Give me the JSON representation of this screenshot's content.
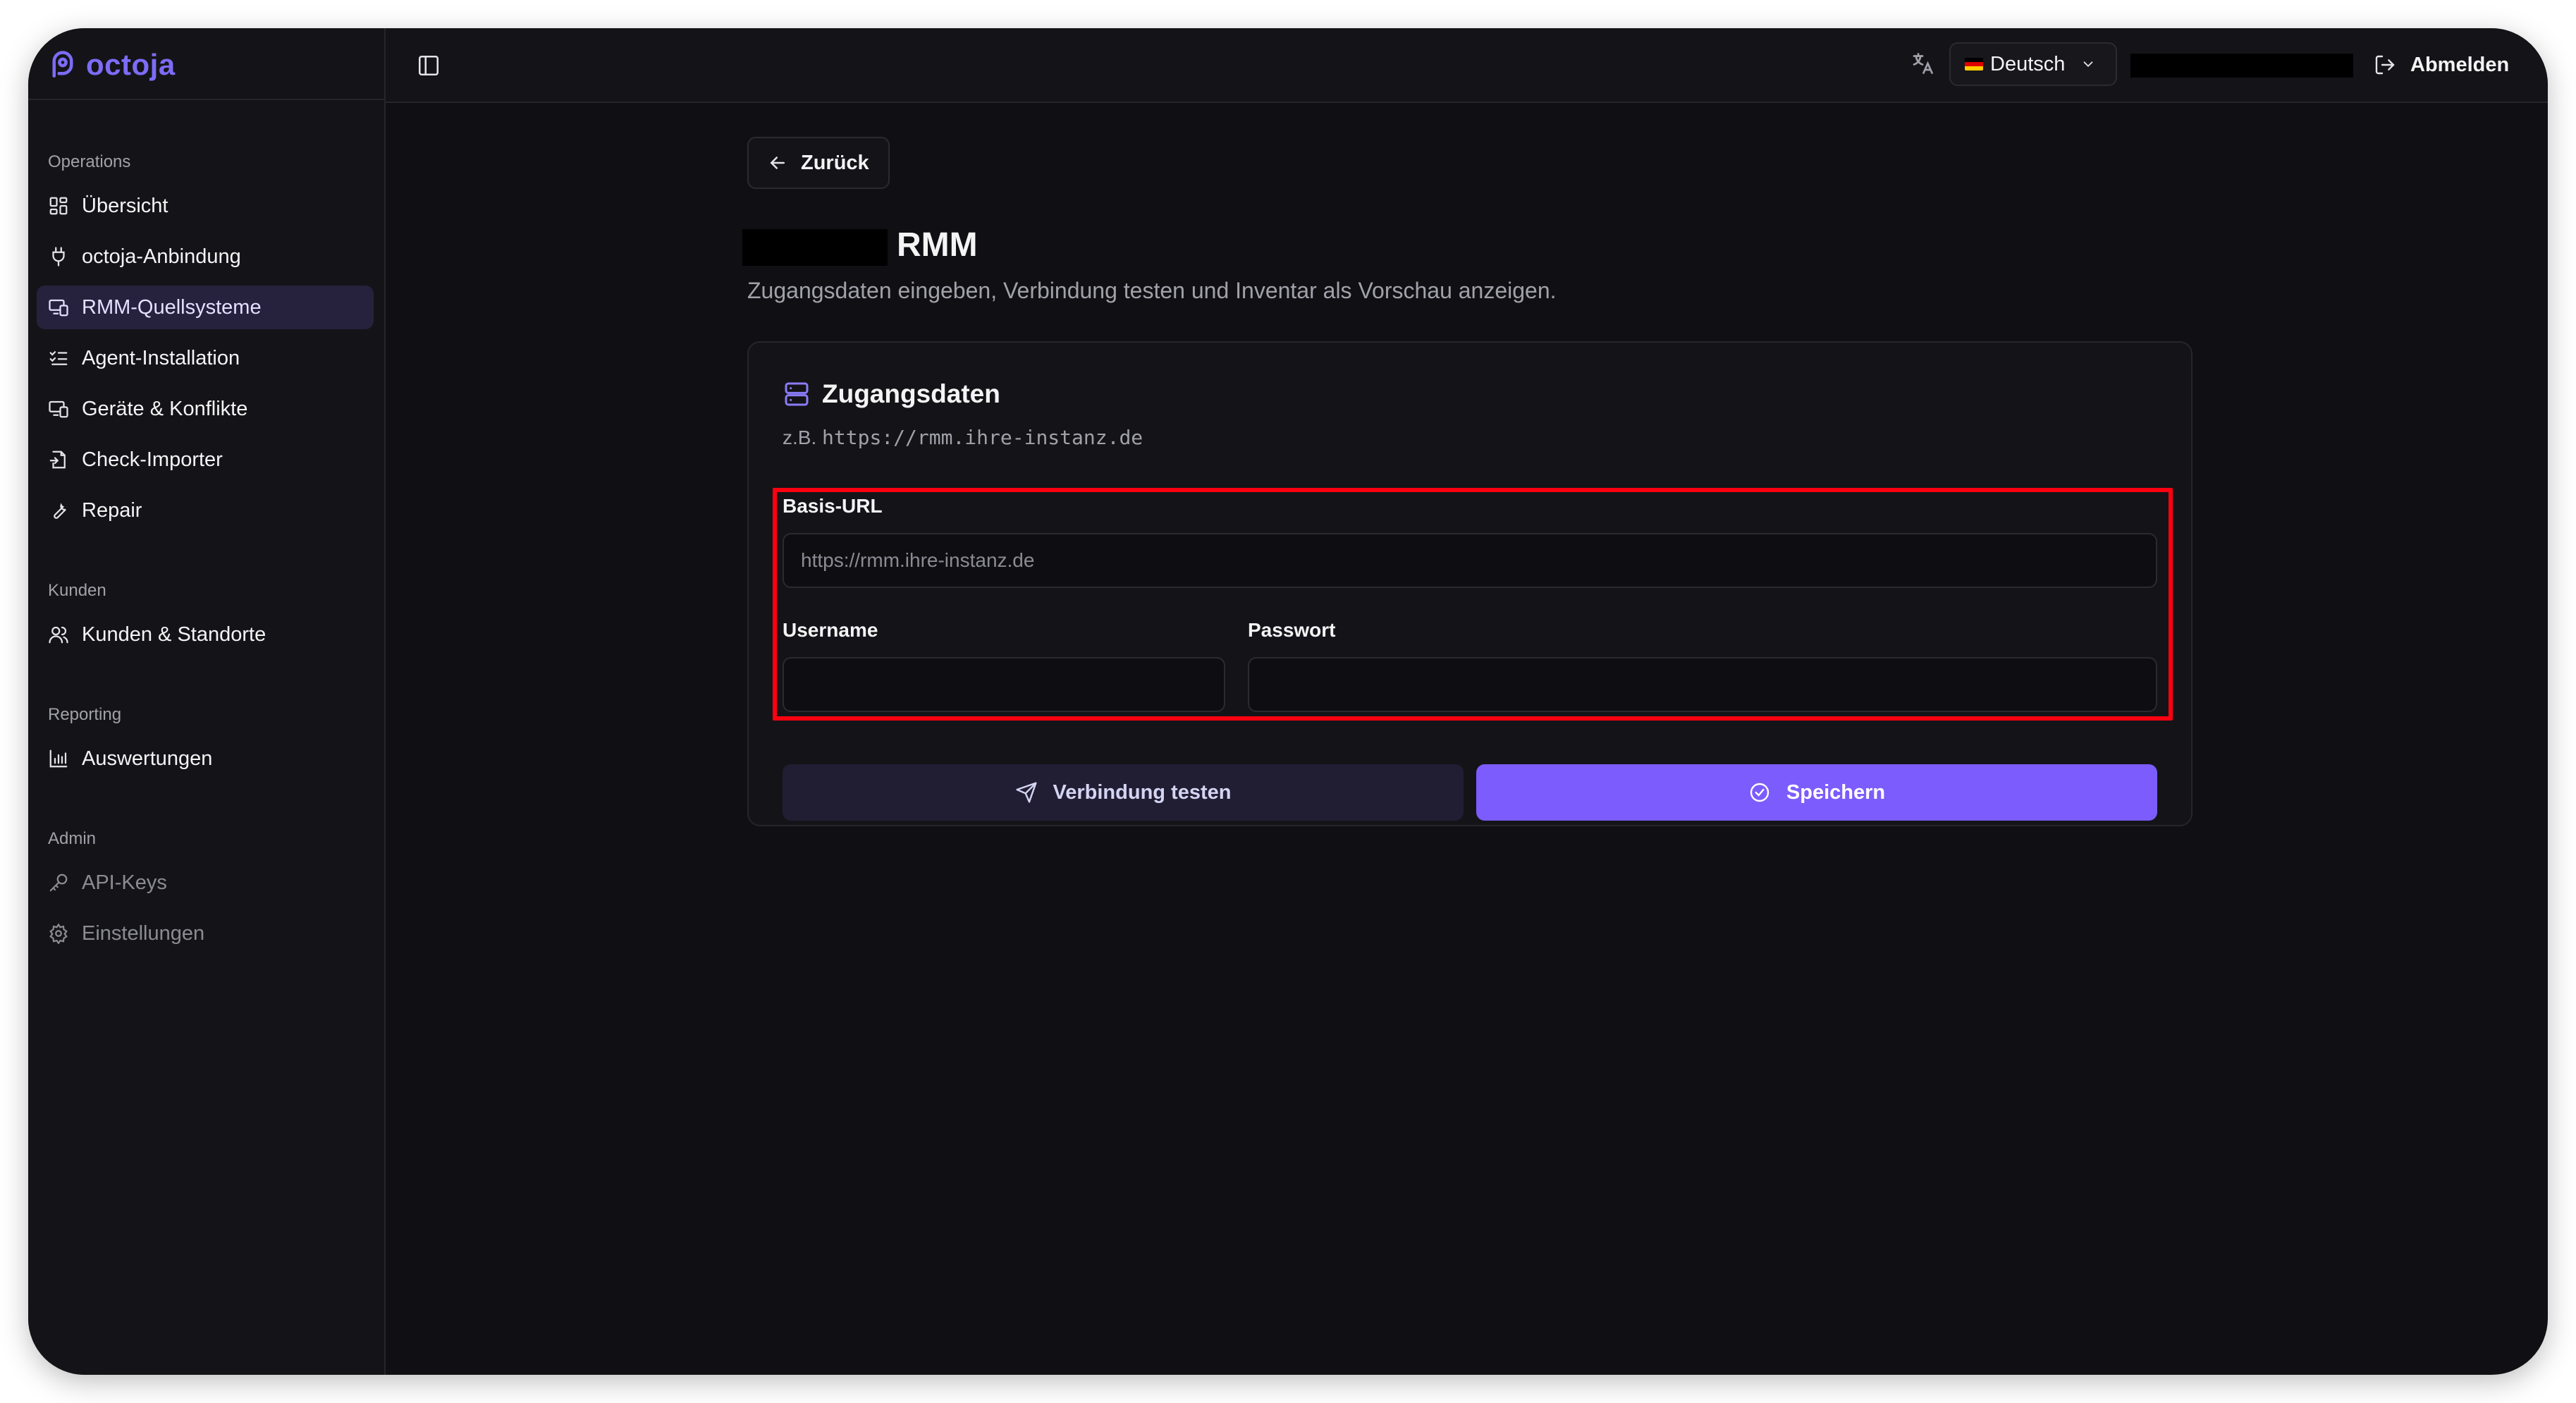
{
  "brand": {
    "name": "octoja"
  },
  "sidebar": {
    "groups": [
      {
        "label": "Operations",
        "items": [
          {
            "label": "Übersicht",
            "icon": "dashboard-icon"
          },
          {
            "label": "octoja-Anbindung",
            "icon": "plug-icon"
          },
          {
            "label": "RMM-Quellsysteme",
            "icon": "devices-icon",
            "active": true
          },
          {
            "label": "Agent-Installation",
            "icon": "list-checks-icon"
          },
          {
            "label": "Geräte & Konflikte",
            "icon": "devices-icon"
          },
          {
            "label": "Check-Importer",
            "icon": "file-import-icon"
          },
          {
            "label": "Repair",
            "icon": "wrench-icon"
          }
        ]
      },
      {
        "label": "Kunden",
        "items": [
          {
            "label": "Kunden & Standorte",
            "icon": "users-icon"
          }
        ]
      },
      {
        "label": "Reporting",
        "items": [
          {
            "label": "Auswertungen",
            "icon": "bar-chart-icon"
          }
        ]
      },
      {
        "label": "Admin",
        "items": [
          {
            "label": "API-Keys",
            "icon": "key-icon",
            "disabled": true
          },
          {
            "label": "Einstellungen",
            "icon": "gear-icon",
            "disabled": true
          }
        ]
      }
    ]
  },
  "topbar": {
    "language": "Deutsch",
    "logout_label": "Abmelden"
  },
  "main": {
    "back_label": "Zurück",
    "title": "RMM",
    "subtitle": "Zugangsdaten eingeben, Verbindung testen und Inventar als Vorschau anzeigen.",
    "card": {
      "title": "Zugangsdaten",
      "hint_prefix": "z.B.",
      "hint_example": "https://rmm.ihre-instanz.de",
      "fields": {
        "base_url": {
          "label": "Basis-URL",
          "placeholder": "https://rmm.ihre-instanz.de",
          "value": ""
        },
        "username": {
          "label": "Username",
          "value": ""
        },
        "password": {
          "label": "Passwort",
          "value": ""
        }
      },
      "test_button": "Verbindung testen",
      "save_button": "Speichern"
    }
  },
  "colors": {
    "accent": "#7c5cfc",
    "background": "#101014",
    "highlight": "#ff0010"
  }
}
